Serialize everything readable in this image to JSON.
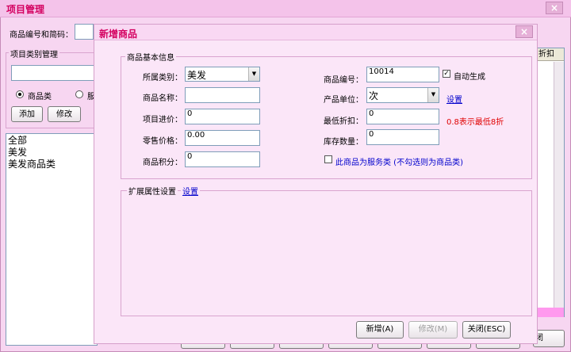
{
  "main_window": {
    "title": "项目管理",
    "close_glyph": "×",
    "search_label": "商品编号和简码：",
    "category_group_label": "项目类别管理",
    "radio_goods": "商品类",
    "radio_service": "服",
    "add_button": "添加",
    "edit_button": "修改",
    "category_tree": [
      "全部",
      "美发",
      "美发商品类"
    ],
    "table_header_partial": "折扣",
    "bottom_right_button_partial": "闭(ESC)"
  },
  "dialog": {
    "title": "新增商品",
    "close_glyph": "×",
    "basic_group_label": "商品基本信息",
    "category_label": "所属类别：",
    "category_value": "美发",
    "name_label": "商品名称：",
    "name_value": "",
    "cost_label": "项目进价：",
    "cost_value": "0",
    "retail_label": "零售价格：",
    "retail_value": "0.00",
    "points_label": "商品积分：",
    "points_value": "0",
    "code_label": "商品编号：",
    "code_value": "10014",
    "auto_generate_label": "自动生成",
    "auto_generate_checked": true,
    "unit_label": "产品单位：",
    "unit_value": "次",
    "unit_settings_link": "设置",
    "min_discount_label": "最低折扣：",
    "min_discount_value": "0",
    "min_discount_hint": "0.8表示最低8折",
    "stock_label": "库存数量：",
    "stock_value": "0",
    "service_checkbox_label": "此商品为服务类 (不勾选则为商品类)",
    "service_checked": false,
    "ext_group_label": "扩展属性设置",
    "ext_settings_link": "设置",
    "add_button": "新增(A)",
    "edit_button": "修改(M)",
    "close_button": "关闭(ESC)"
  },
  "colors": {
    "dialog_title": "#d40060",
    "hint_red": "#e00000",
    "link_blue": "#0000cc",
    "background_pink": "#f7d6f1"
  }
}
